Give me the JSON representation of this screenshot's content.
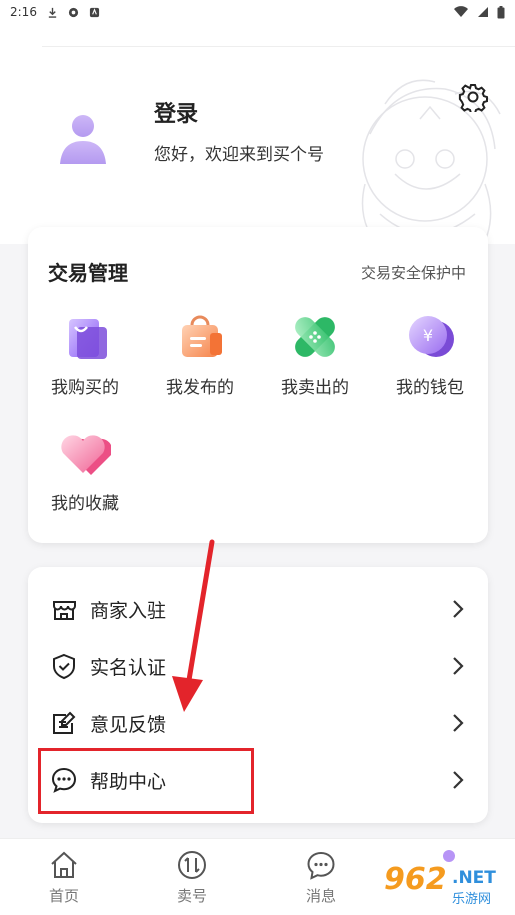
{
  "status_bar": {
    "time": "2:16"
  },
  "profile": {
    "title": "登录",
    "subtitle": "您好，欢迎来到买个号"
  },
  "trade": {
    "title": "交易管理",
    "subtitle": "交易安全保护中",
    "items": [
      {
        "label": "我购买的",
        "icon": "purchase-bag-icon"
      },
      {
        "label": "我发布的",
        "icon": "publish-bag-icon"
      },
      {
        "label": "我卖出的",
        "icon": "sold-bandage-icon"
      },
      {
        "label": "我的钱包",
        "icon": "wallet-coin-icon"
      },
      {
        "label": "我的收藏",
        "icon": "favorite-heart-icon"
      }
    ]
  },
  "menu": {
    "items": [
      {
        "label": "商家入驻",
        "icon": "store-icon"
      },
      {
        "label": "实名认证",
        "icon": "shield-check-icon"
      },
      {
        "label": "意见反馈",
        "icon": "edit-note-icon"
      },
      {
        "label": "帮助中心",
        "icon": "chat-bubble-icon"
      }
    ]
  },
  "tabbar": {
    "items": [
      {
        "label": "首页",
        "icon": "home-icon"
      },
      {
        "label": "卖号",
        "icon": "swap-icon"
      },
      {
        "label": "消息",
        "icon": "message-icon"
      }
    ]
  },
  "watermark": {
    "num": "962",
    "net": ".NET",
    "cn": "乐游网"
  },
  "colors": {
    "accent_purple": "#b794f6",
    "highlight_red": "#e3242b"
  }
}
